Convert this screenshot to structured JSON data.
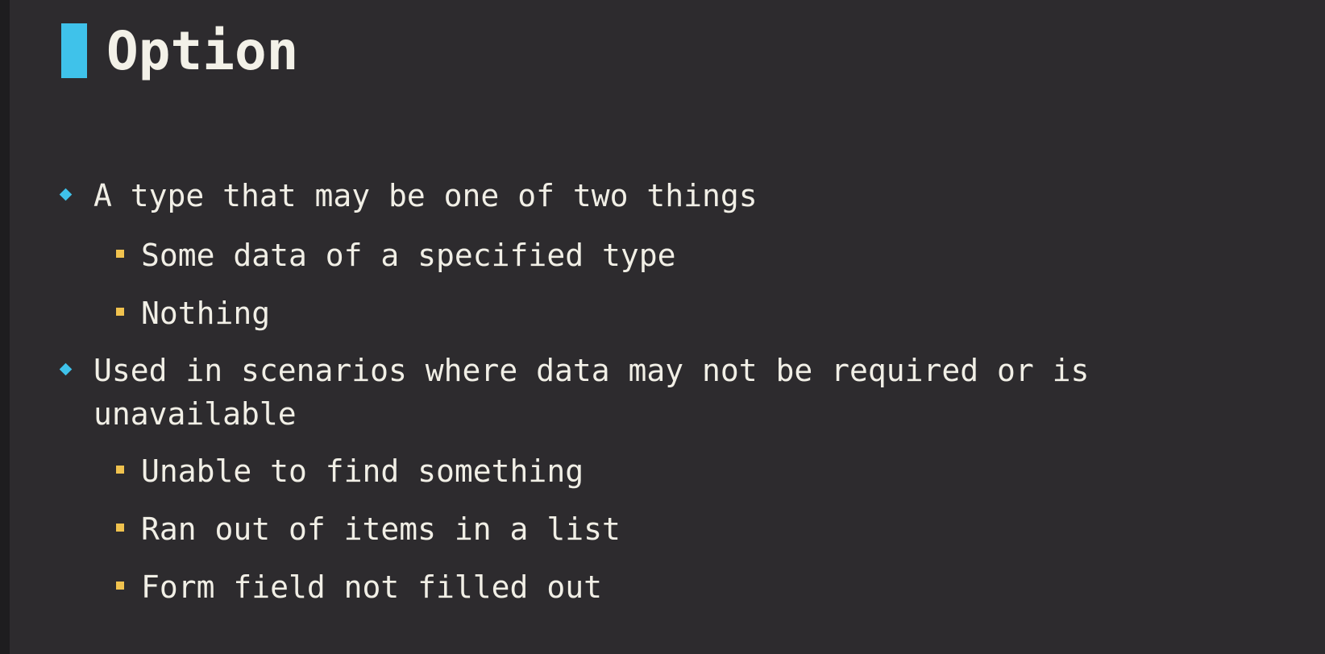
{
  "slide": {
    "title": "Option",
    "accent_color": "#3fc2ea",
    "sub_bullet_color": "#f0c24e",
    "background_color": "#2d2b2e"
  },
  "bullets": [
    {
      "icon": "diamond-bullet-icon",
      "text": "A type that may be one of two things",
      "sub": [
        {
          "icon": "square-bullet-icon",
          "text": "Some data of a specified type"
        },
        {
          "icon": "square-bullet-icon",
          "text": "Nothing"
        }
      ]
    },
    {
      "icon": "diamond-bullet-icon",
      "text_line1": "Used in scenarios where data may not be required or is",
      "text_line2": "unavailable",
      "sub": [
        {
          "icon": "square-bullet-icon",
          "text": "Unable to find something"
        },
        {
          "icon": "square-bullet-icon",
          "text": "Ran out of items in a list"
        },
        {
          "icon": "square-bullet-icon",
          "text": "Form field not filled out"
        }
      ]
    }
  ]
}
